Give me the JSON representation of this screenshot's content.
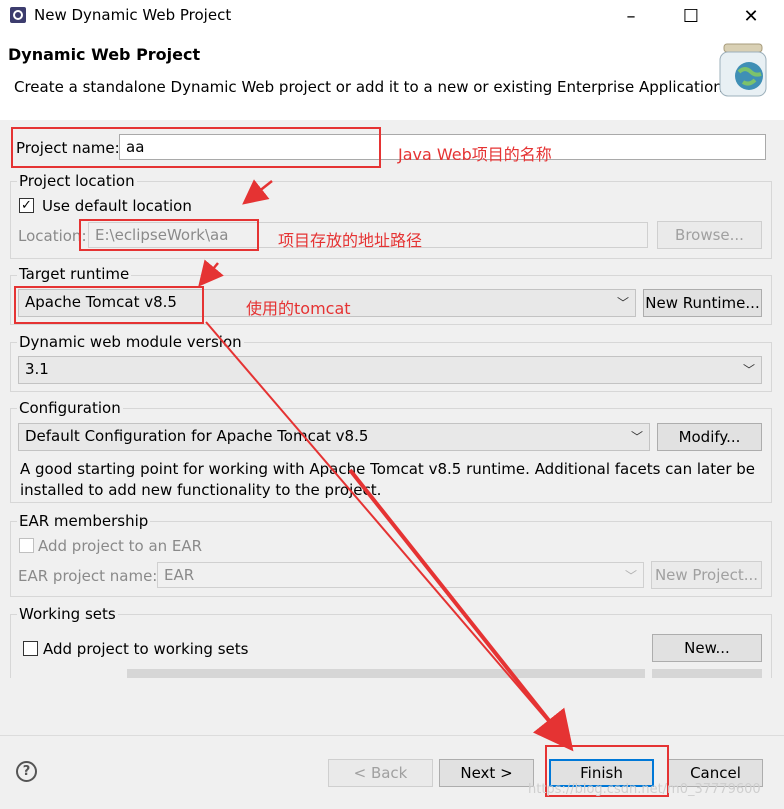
{
  "window": {
    "title": "New Dynamic Web Project",
    "min_icon": "minimize-icon",
    "max_icon": "maximize-icon",
    "close_icon": "close-icon"
  },
  "header": {
    "title": "Dynamic Web Project",
    "description": "Create a standalone Dynamic Web project or add it to a new or existing Enterprise Application."
  },
  "project_name": {
    "label": "Project name:",
    "value": "aa"
  },
  "project_location": {
    "group_label": "Project location",
    "use_default_label": "Use default location",
    "use_default_checked": true,
    "location_label": "Location:",
    "location_value": "E:\\eclipseWork\\aa",
    "browse_label": "Browse..."
  },
  "target_runtime": {
    "group_label": "Target runtime",
    "value": "Apache Tomcat v8.5",
    "new_runtime_label": "New Runtime..."
  },
  "module_version": {
    "group_label": "Dynamic web module version",
    "value": "3.1"
  },
  "configuration": {
    "group_label": "Configuration",
    "value": "Default Configuration for Apache Tomcat v8.5",
    "modify_label": "Modify...",
    "description": "A good starting point for working with Apache Tomcat v8.5 runtime. Additional facets can later be installed to add new functionality to the project."
  },
  "ear": {
    "group_label": "EAR membership",
    "add_label": "Add project to an EAR",
    "project_name_label": "EAR project name:",
    "project_name_value": "EAR",
    "new_project_label": "New Project..."
  },
  "working_sets": {
    "group_label": "Working sets",
    "add_label": "Add project to working sets",
    "new_label": "New..."
  },
  "footer": {
    "back_label": "< Back",
    "next_label": "Next >",
    "finish_label": "Finish",
    "cancel_label": "Cancel"
  },
  "annotations": {
    "project_name_note": "Java Web项目的名称",
    "location_note": "项目存放的地址路径",
    "runtime_note": "使用的tomcat",
    "watermark": "https://blog.csdn.net/m0_37779600"
  },
  "colors": {
    "annotation_red": "#e53333",
    "finish_border": "#0078d7",
    "panel_bg": "#f0f0f0"
  }
}
